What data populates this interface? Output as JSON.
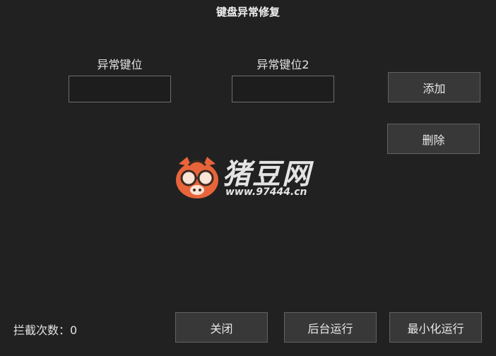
{
  "window": {
    "title": "键盘异常修复"
  },
  "form": {
    "key1_label": "异常键位",
    "key1_value": "",
    "key2_label": "异常键位2",
    "key2_value": ""
  },
  "actions": {
    "add_label": "添加",
    "delete_label": "删除"
  },
  "status": {
    "intercept_text": "拦截次数：0"
  },
  "footer": {
    "close_label": "关闭",
    "background_label": "后台运行",
    "minimize_label": "最小化运行"
  },
  "watermark": {
    "brand": "猪豆网",
    "url": "www.97444.cn",
    "icon": "pig-logo-icon",
    "logo_color": "#e8643a"
  }
}
